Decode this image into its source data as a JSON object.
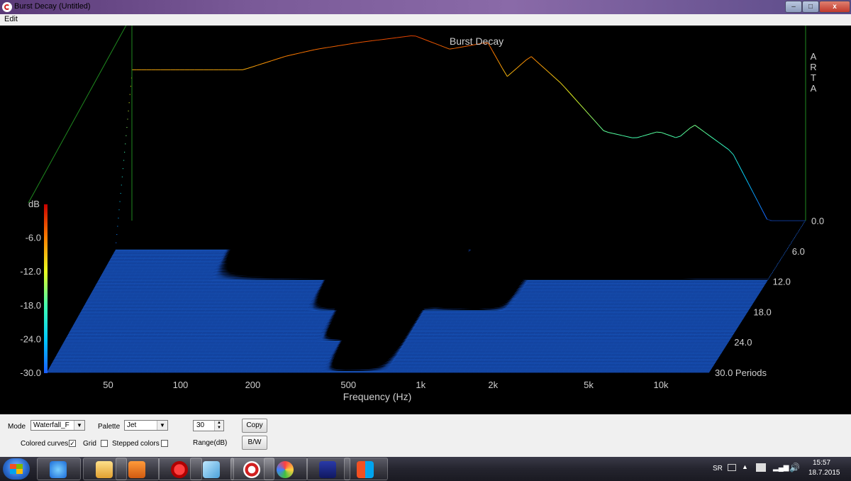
{
  "window": {
    "title": "Burst Decay  (Untitled)",
    "min_label": "–",
    "max_label": "□",
    "close_label": "x"
  },
  "menu": {
    "edit": "Edit"
  },
  "chart_data": {
    "type": "waterfall",
    "title": "Burst Decay",
    "watermark": [
      "A",
      "R",
      "T",
      "A"
    ],
    "xlabel": "Frequency (Hz)",
    "x_ticks": [
      "50",
      "100",
      "200",
      "500",
      "1k",
      "2k",
      "5k",
      "10k"
    ],
    "x_tick_values": [
      50,
      100,
      200,
      500,
      1000,
      2000,
      5000,
      10000
    ],
    "xlim": [
      35,
      20000
    ],
    "x_scale": "log",
    "ylabel": "dB",
    "y_ticks": [
      "-6.0",
      "-12.0",
      "-18.0",
      "-24.0",
      "-30.0"
    ],
    "ylim": [
      -30,
      0
    ],
    "z_ticks": [
      "0.0",
      "6.0",
      "12.0",
      "18.0",
      "24.0",
      "30.0 Periods"
    ],
    "zlim": [
      0,
      30
    ],
    "colormap": "jet",
    "series": [
      {
        "name": "0.0 Periods",
        "frequency_hz": [
          100,
          150,
          200,
          300,
          500,
          700,
          1000,
          1200,
          1500,
          2000,
          3000,
          4000,
          5000,
          6000,
          7000,
          10000,
          14000
        ],
        "db": [
          -8,
          -6,
          -5,
          -4,
          -3,
          -5,
          -4,
          -9,
          -6,
          -10,
          -17,
          -18,
          -17,
          -18,
          -16,
          -20,
          -30
        ]
      },
      {
        "name": "6.0 Periods",
        "frequency_hz": [
          100,
          200,
          400,
          500,
          700,
          1000,
          1500,
          2000,
          5000,
          7000,
          10000
        ],
        "db": [
          -30,
          -26,
          -22,
          -20,
          -24,
          -30,
          -22,
          -24,
          -20,
          -20,
          -26
        ]
      },
      {
        "name": "12.0 Periods",
        "frequency_hz": [
          300,
          500,
          700,
          1000,
          1500,
          2000
        ],
        "db": [
          -30,
          -22,
          -24,
          -28,
          -24,
          -30
        ]
      },
      {
        "name": "18.0 Periods",
        "frequency_hz": [
          400,
          500,
          700,
          900
        ],
        "db": [
          -30,
          -24,
          -25,
          -30
        ]
      },
      {
        "name": "24.0 Periods",
        "frequency_hz": [
          500,
          600,
          700,
          900
        ],
        "db": [
          -30,
          -25,
          -26,
          -30
        ]
      },
      {
        "name": "30.0 Periods",
        "frequency_hz": [
          500,
          700
        ],
        "db": [
          -30,
          -30
        ]
      }
    ],
    "colors": {
      "background": "#000000",
      "floor": "#1b5fd0",
      "axes_text": "#cfcfcf",
      "box": "#1f8a1f"
    }
  },
  "controls": {
    "mode_label": "Mode",
    "mode_value": "Waterfall_F",
    "palette_label": "Palette",
    "palette_value": "Jet",
    "range_value": "30",
    "range_label": "Range(dB)",
    "copy_label": "Copy",
    "bw_label": "B/W",
    "colored_curves_label": "Colored curves",
    "colored_curves_checked": true,
    "grid_label": "Grid",
    "grid_checked": false,
    "stepped_colors_label": "Stepped colors",
    "stepped_colors_checked": false
  },
  "taskbar": {
    "apps": [
      "internet-explorer",
      "file-explorer",
      "media-player",
      "opera",
      "notes",
      "arta",
      "paint",
      "dsp",
      "windows-explorer"
    ],
    "lang": "SR",
    "time": "15:57",
    "date": "18.7.2015"
  }
}
